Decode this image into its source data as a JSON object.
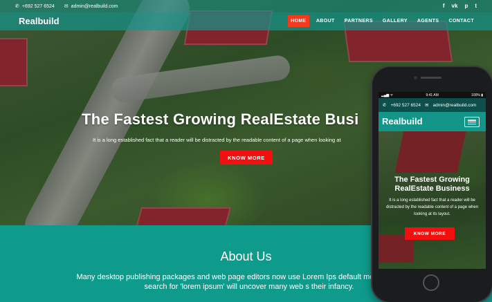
{
  "desktop": {
    "topbar": {
      "phone": "+692 527 6524",
      "email": "admin@realbuild.com",
      "social": [
        {
          "icon": "facebook-icon",
          "glyph": "f"
        },
        {
          "icon": "vk-icon",
          "glyph": "vk"
        },
        {
          "icon": "pinterest-icon",
          "glyph": "p"
        },
        {
          "icon": "twitter-icon",
          "glyph": "t"
        }
      ]
    },
    "navbar": {
      "logo": "Realbuild",
      "menu": [
        "HOME",
        "ABOUT",
        "PARTNERS",
        "GALLERY",
        "AGENTS",
        "CONTACT"
      ],
      "active_index": 0
    },
    "hero": {
      "title": "The Fastest Growing RealEstate Busi",
      "subtitle": "It is a long established fact that a reader will be distracted by the readable content of a page when looking at",
      "button": "KNOW MORE"
    },
    "about": {
      "title": "About Us",
      "text": "Many desktop publishing packages and web page editors now use Lorem Ips default model text, and a search for 'lorem ipsum' will uncover many web s their infancy."
    }
  },
  "phone": {
    "status": {
      "left": "▂▄▆ ᯤ",
      "time": "9:41 AM",
      "right": "100% ▮"
    },
    "topbar": {
      "phone": "+692 527 6524",
      "email": "admin@realbuild.com"
    },
    "logo": "Realbuild",
    "hero": {
      "title": "The Fastest Growing RealEstate Business",
      "subtitle": "It is a long established fact that a reader will be distracted by the readable content of a page when looking at its layout.",
      "button": "KNOW MORE"
    }
  },
  "colors": {
    "teal": "#0f9b8c",
    "accent_red": "#f20f0f",
    "active_menu": "#f23a1e"
  }
}
